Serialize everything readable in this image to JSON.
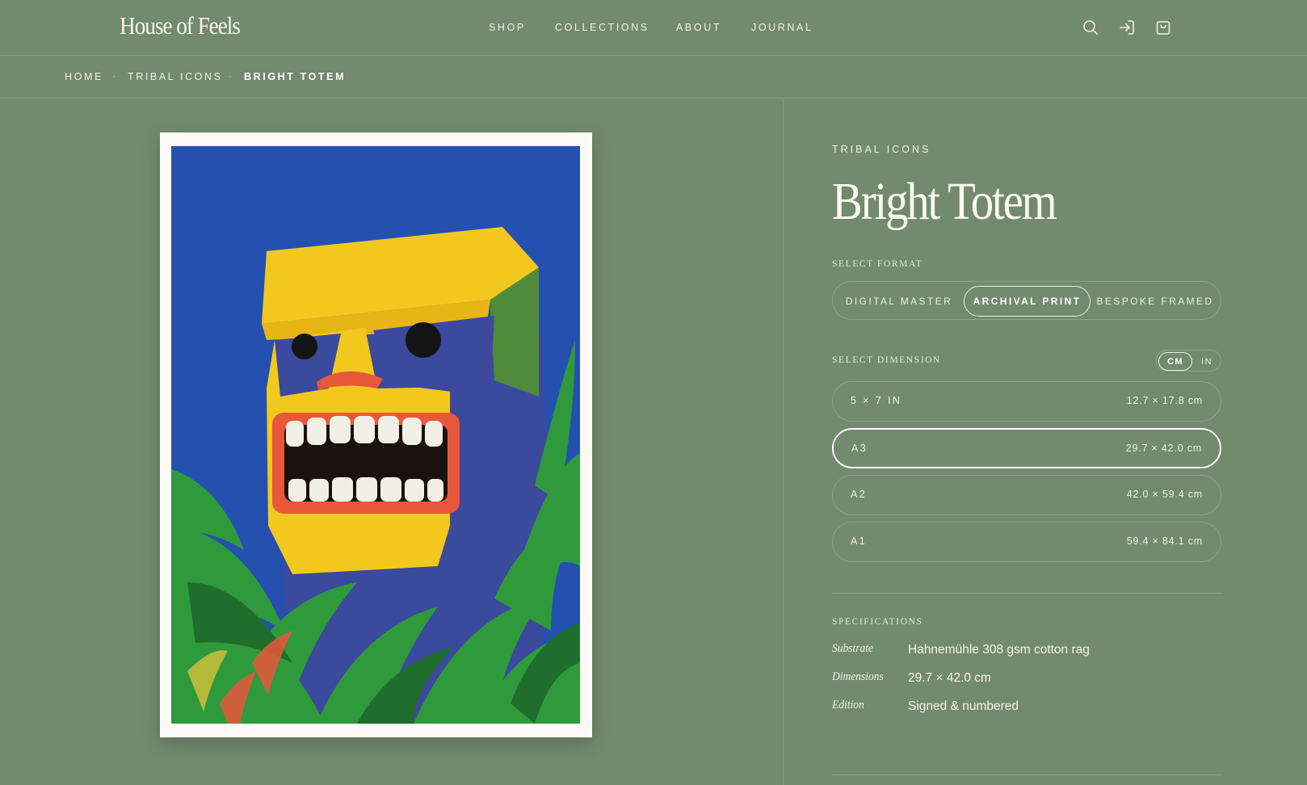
{
  "header": {
    "logo": "House of Feels",
    "nav": [
      "SHOP",
      "COLLECTIONS",
      "ABOUT",
      "JOURNAL"
    ],
    "icons": [
      "search-icon",
      "sign-in-icon",
      "shopping-bag-icon"
    ]
  },
  "breadcrumb": {
    "items": [
      "HOME",
      "TRIBAL ICONS",
      "BRIGHT TOTEM"
    ],
    "separator": "·"
  },
  "product": {
    "collection": "TRIBAL ICONS",
    "title": "Bright Totem",
    "format_label": "SELECT FORMAT",
    "formats": [
      "DIGITAL MASTER",
      "ARCHIVAL PRINT",
      "BESPOKE FRAMED"
    ],
    "selected_format": "ARCHIVAL PRINT",
    "dimension_label": "SELECT DIMENSION",
    "units": [
      "CM",
      "IN"
    ],
    "selected_unit": "CM",
    "dimensions": [
      {
        "name": "5 × 7 IN",
        "size": "12.7 × 17.8 cm"
      },
      {
        "name": "A3",
        "size": "29.7 × 42.0 cm"
      },
      {
        "name": "A2",
        "size": "42.0 × 59.4 cm"
      },
      {
        "name": "A1",
        "size": "59.4 × 84.1 cm"
      }
    ],
    "selected_dimension": "A3"
  },
  "specifications": {
    "label": "SPECIFICATIONS",
    "rows": [
      {
        "key": "Substrate",
        "value": "Hahnemühle 308 gsm cotton rag"
      },
      {
        "key": "Dimensions",
        "value": "29.7 × 42.0 cm"
      },
      {
        "key": "Edition",
        "value": "Signed & numbered"
      }
    ]
  },
  "colors": {
    "background": "#728a6d",
    "text": "#f4f1ea",
    "art_sky": "#2450b0",
    "totem_yellow": "#f2c81e",
    "totem_blue": "#3b4a9c",
    "foliage": "#2f9a3c"
  }
}
